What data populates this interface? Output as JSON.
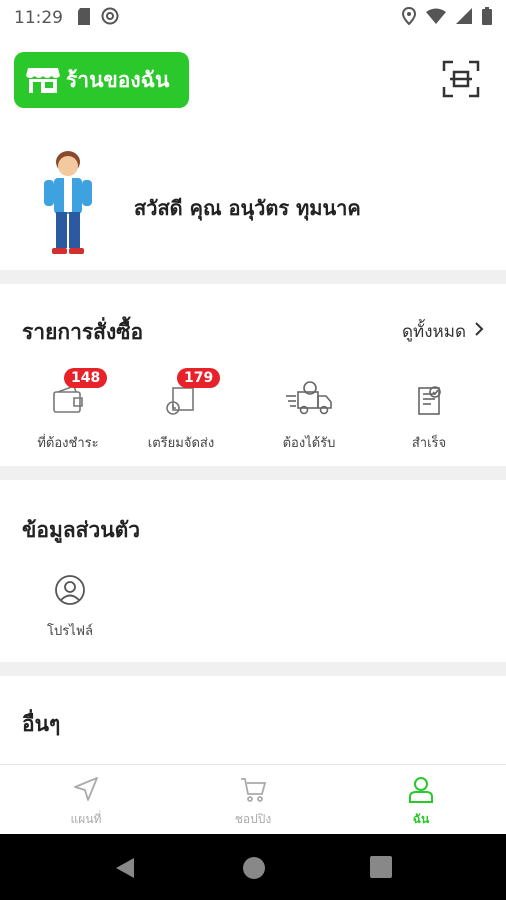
{
  "status_bar": {
    "time": "11:29",
    "left_icons": [
      "sd-card-icon",
      "at-sign-icon"
    ],
    "right_icons": [
      "location-icon",
      "wifi-icon",
      "signal-icon",
      "battery-icon"
    ]
  },
  "header": {
    "shop_button_label": "ร้านของฉัน",
    "shop_icon": "store-icon",
    "scan_icon": "scan-icon"
  },
  "greeting": {
    "text": "สวัสดี คุณ อนุวัตร ทุมนาค"
  },
  "orders": {
    "title": "รายการสั่งซื้อ",
    "see_all": "ดูทั้งหมด",
    "items": [
      {
        "label": "ที่ต้องชำระ",
        "badge": "148",
        "icon": "wallet-icon"
      },
      {
        "label": "เตรียมจัดส่ง",
        "badge": "179",
        "icon": "package-icon"
      },
      {
        "label": "ต้องได้รับ",
        "badge": "",
        "icon": "delivery-truck-icon"
      },
      {
        "label": "สำเร็จ",
        "badge": "",
        "icon": "completed-icon"
      }
    ]
  },
  "personal": {
    "title": "ข้อมูลส่วนตัว",
    "profile_label": "โปรไฟล์"
  },
  "others": {
    "title": "อื่นๆ"
  },
  "bottom_nav": {
    "items": [
      {
        "label": "แผนที่",
        "icon": "map-arrow-icon",
        "active": false
      },
      {
        "label": "ชอปปิง",
        "icon": "cart-icon",
        "active": false
      },
      {
        "label": "ฉัน",
        "icon": "user-icon",
        "active": true
      }
    ]
  },
  "colors": {
    "brand_green": "#2bc82b",
    "badge_red": "#e8222a",
    "divider": "#f0f0f0"
  }
}
